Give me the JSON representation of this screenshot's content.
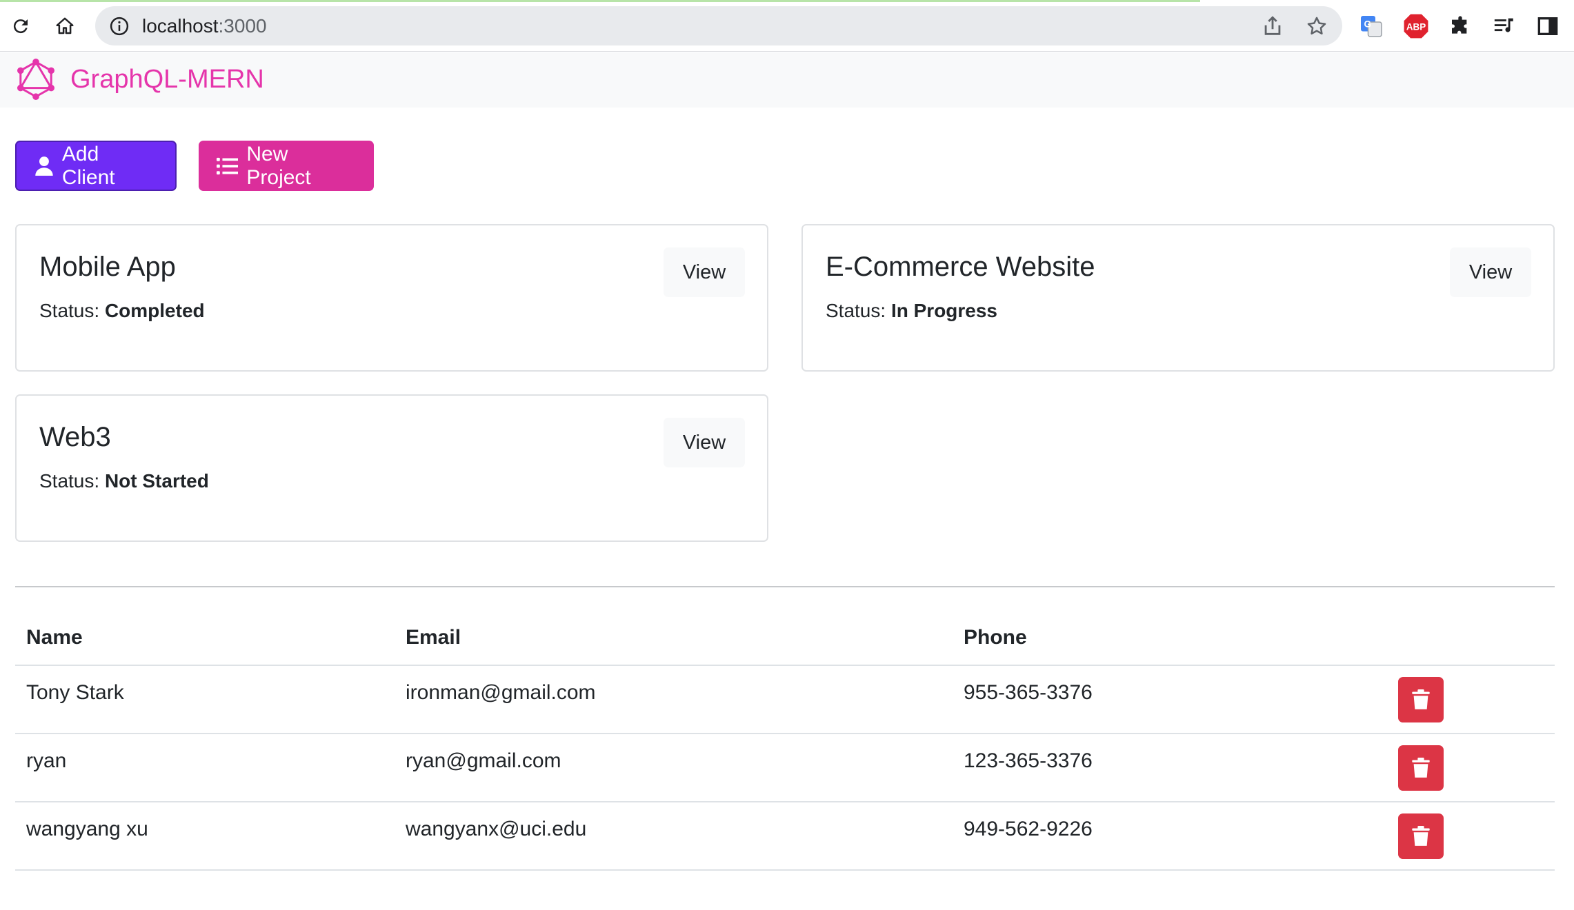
{
  "browser": {
    "url_host": "localhost",
    "url_port": ":3000",
    "icons": [
      "reload-icon",
      "home-icon",
      "info-icon",
      "share-icon",
      "star-icon",
      "google-translate-icon",
      "adblock-icon",
      "extensions-icon",
      "media-icon",
      "side-panel-icon"
    ],
    "adblock_label": "ABP"
  },
  "app": {
    "brand": "GraphQL-MERN",
    "brand_color": "#e535ab"
  },
  "actions": {
    "add_client": "Add Client",
    "new_project": "New Project"
  },
  "projects": [
    {
      "name": "Mobile App",
      "status_label": "Status:",
      "status": "Completed",
      "view": "View"
    },
    {
      "name": "E-Commerce Website",
      "status_label": "Status:",
      "status": "In Progress",
      "view": "View"
    },
    {
      "name": "Web3",
      "status_label": "Status:",
      "status": "Not Started",
      "view": "View"
    }
  ],
  "clients": {
    "headers": [
      "Name",
      "Email",
      "Phone"
    ],
    "rows": [
      {
        "name": "Tony Stark",
        "email": "ironman@gmail.com",
        "phone": "955-365-3376"
      },
      {
        "name": "ryan",
        "email": "ryan@gmail.com",
        "phone": "123-365-3376"
      },
      {
        "name": "wangyang xu",
        "email": "wangyanx@uci.edu",
        "phone": "949-562-9226"
      }
    ]
  },
  "colors": {
    "add_client": "#6f2cf5",
    "new_project": "#db2e9b",
    "delete": "#dc3545"
  }
}
